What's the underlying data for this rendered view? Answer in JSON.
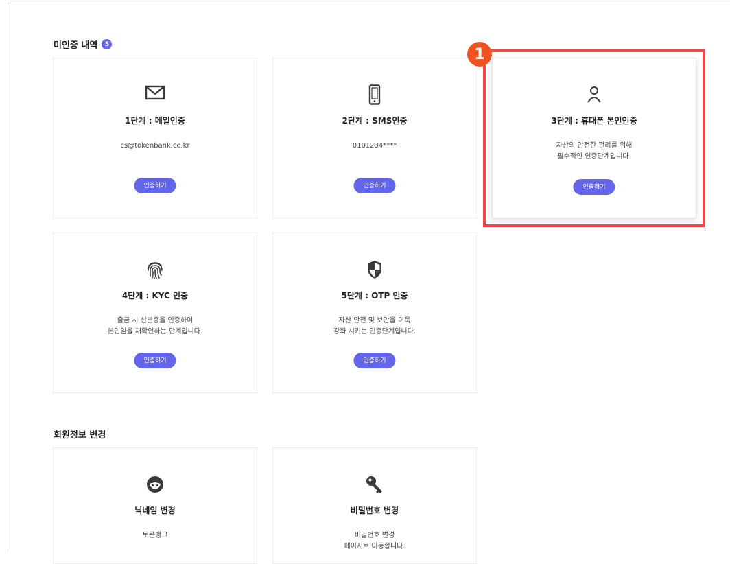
{
  "unverified": {
    "title": "미인증 내역",
    "count": "5",
    "button_label": "인증하기",
    "cards": [
      {
        "title": "1단계 : 메일인증",
        "desc1": "cs@tokenbank.co.kr",
        "desc2": "",
        "icon": "envelope-icon"
      },
      {
        "title": "2단계 : SMS인증",
        "desc1": "0101234****",
        "desc2": "",
        "icon": "phone-icon"
      },
      {
        "title": "3단계 : 휴대폰 본인인증",
        "desc1": "자산의 안전한 관리를 위해",
        "desc2": "필수적인 인증단계입니다.",
        "icon": "person-icon"
      },
      {
        "title": "4단계 : KYC 인증",
        "desc1": "출금 시 신분증을 인증하여",
        "desc2": "본인임을 재확인하는 단계입니다.",
        "icon": "fingerprint-icon"
      },
      {
        "title": "5단계 : OTP 인증",
        "desc1": "자산 안전 및 보안을 더욱",
        "desc2": "강화 시키는 인증단계입니다.",
        "icon": "shield-icon"
      }
    ]
  },
  "member": {
    "title": "회원정보 변경",
    "cards": [
      {
        "title": "닉네임 변경",
        "desc1": "토큰뱅크",
        "desc2": "",
        "icon": "face-icon"
      },
      {
        "title": "비밀번호 변경",
        "desc1": "비밀번호 변경",
        "desc2": "페이지로 이동합니다.",
        "icon": "key-icon"
      }
    ]
  },
  "annotation": {
    "number": "1",
    "color": "#ee5422",
    "box_color": "#f0474b"
  },
  "colors": {
    "accent": "#6366e8"
  }
}
